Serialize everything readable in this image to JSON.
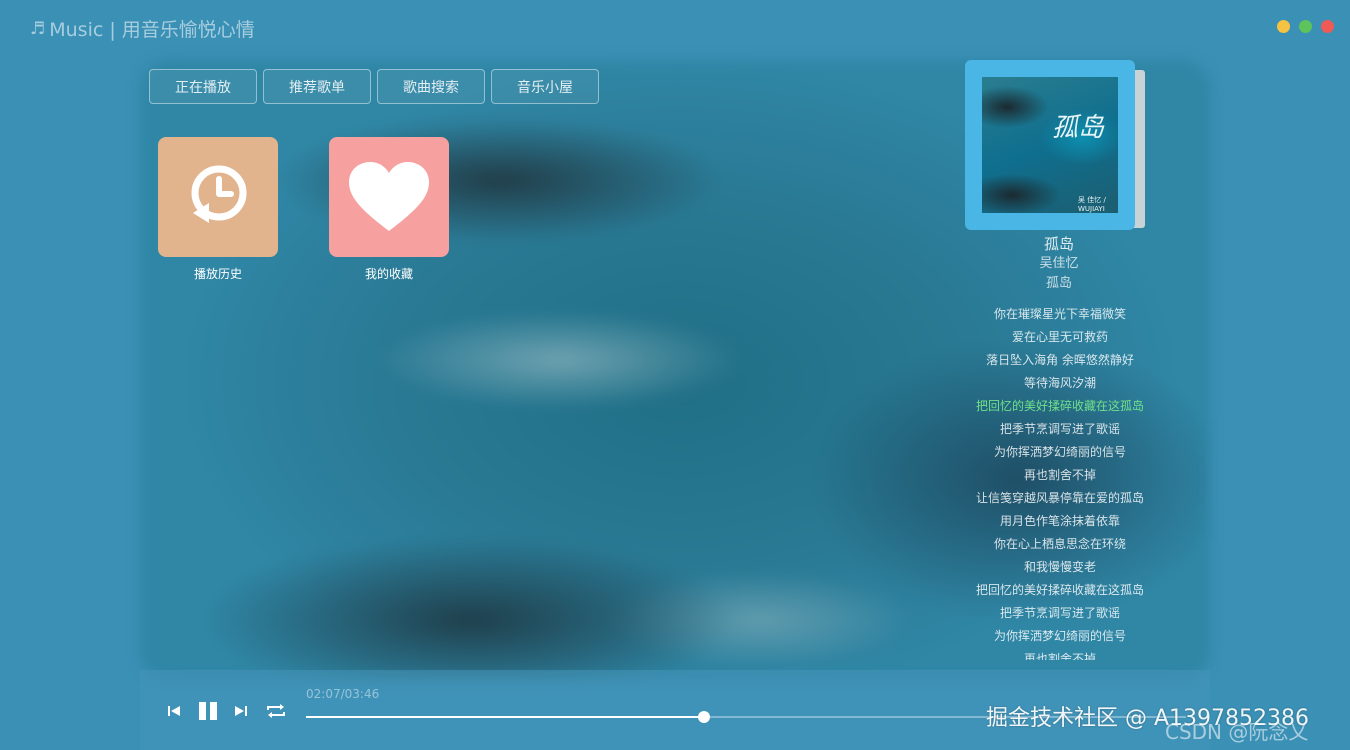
{
  "app": {
    "title": "Music | 用音乐愉悦心情",
    "note_icon": "music-note-icon"
  },
  "window_controls": {
    "colors": {
      "minimize": "#f5c242",
      "maximize": "#5dc35a",
      "close": "#ee5a55"
    }
  },
  "tabs": [
    {
      "label": "正在播放"
    },
    {
      "label": "推荐歌单"
    },
    {
      "label": "歌曲搜索"
    },
    {
      "label": "音乐小屋"
    }
  ],
  "tiles": [
    {
      "label": "播放历史",
      "icon": "history-clock-icon",
      "color": "#e2b48e"
    },
    {
      "label": "我的收藏",
      "icon": "heart-icon",
      "color": "#f7a0a0"
    }
  ],
  "now_playing": {
    "cover_text": "孤岛",
    "cover_small": "吴 佳忆 / WUJIAYI",
    "title": "孤岛",
    "artist": "吴佳忆",
    "album": "孤岛"
  },
  "lyrics": {
    "active_index": 4,
    "active_color": "#6fe08a",
    "lines": [
      "你在璀璨星光下幸福微笑",
      "爱在心里无可救药",
      "落日坠入海角 余晖悠然静好",
      "等待海风汐潮",
      "把回忆的美好揉碎收藏在这孤岛",
      "把季节烹调写进了歌谣",
      "为你挥洒梦幻绮丽的信号",
      "再也割舍不掉",
      "让信笺穿越风暴停靠在爱的孤岛",
      "用月色作笔涂抹着依靠",
      "你在心上栖息思念在环绕",
      "和我慢慢变老",
      "把回忆的美好揉碎收藏在这孤岛",
      "把季节烹调写进了歌谣",
      "为你挥洒梦幻绮丽的信号",
      "再也割舍不掉"
    ]
  },
  "player": {
    "time_display": "02:07/03:46",
    "progress": 0.452,
    "controls": [
      "previous-icon",
      "pause-icon",
      "next-icon",
      "repeat-icon"
    ]
  },
  "watermarks": {
    "line1": "掘金技术社区 @ A1397852386",
    "line2": "CSDN @阮念乂"
  }
}
